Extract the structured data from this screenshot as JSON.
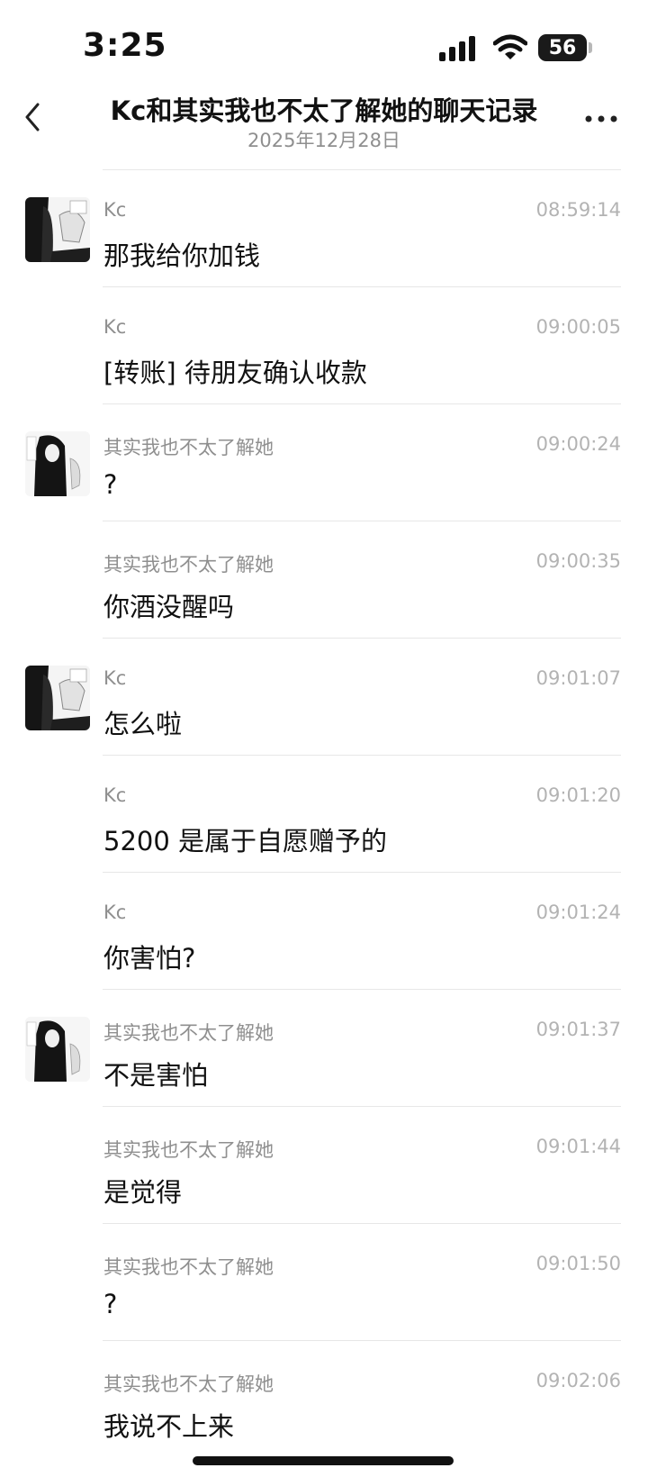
{
  "status_bar": {
    "time": "3:25",
    "battery": "56"
  },
  "header": {
    "title": "Kc和其实我也不太了解她的聊天记录",
    "subtitle": "2025年12月28日",
    "back_icon": "chevron-left-icon",
    "more_icon": "more-horizontal-icon"
  },
  "messages": [
    {
      "sender": "Kc",
      "time": "08:59:14",
      "text": "那我给你加钱"
    },
    {
      "sender": "Kc",
      "time": "09:00:05",
      "text": "[转账] 待朋友确认收款"
    },
    {
      "sender": "其实我也不太了解她",
      "time": "09:00:24",
      "text": "?"
    },
    {
      "sender": "其实我也不太了解她",
      "time": "09:00:35",
      "text": "你酒没醒吗"
    },
    {
      "sender": "Kc",
      "time": "09:01:07",
      "text": "怎么啦"
    },
    {
      "sender": "Kc",
      "time": "09:01:20",
      "text": "5200 是属于自愿赠予的"
    },
    {
      "sender": "Kc",
      "time": "09:01:24",
      "text": "你害怕?"
    },
    {
      "sender": "其实我也不太了解她",
      "time": "09:01:37",
      "text": "不是害怕"
    },
    {
      "sender": "其实我也不太了解她",
      "time": "09:01:44",
      "text": "是觉得"
    },
    {
      "sender": "其实我也不太了解她",
      "time": "09:01:50",
      "text": "?"
    },
    {
      "sender": "其实我也不太了解她",
      "time": "09:02:06",
      "text": "我说不上来"
    }
  ]
}
